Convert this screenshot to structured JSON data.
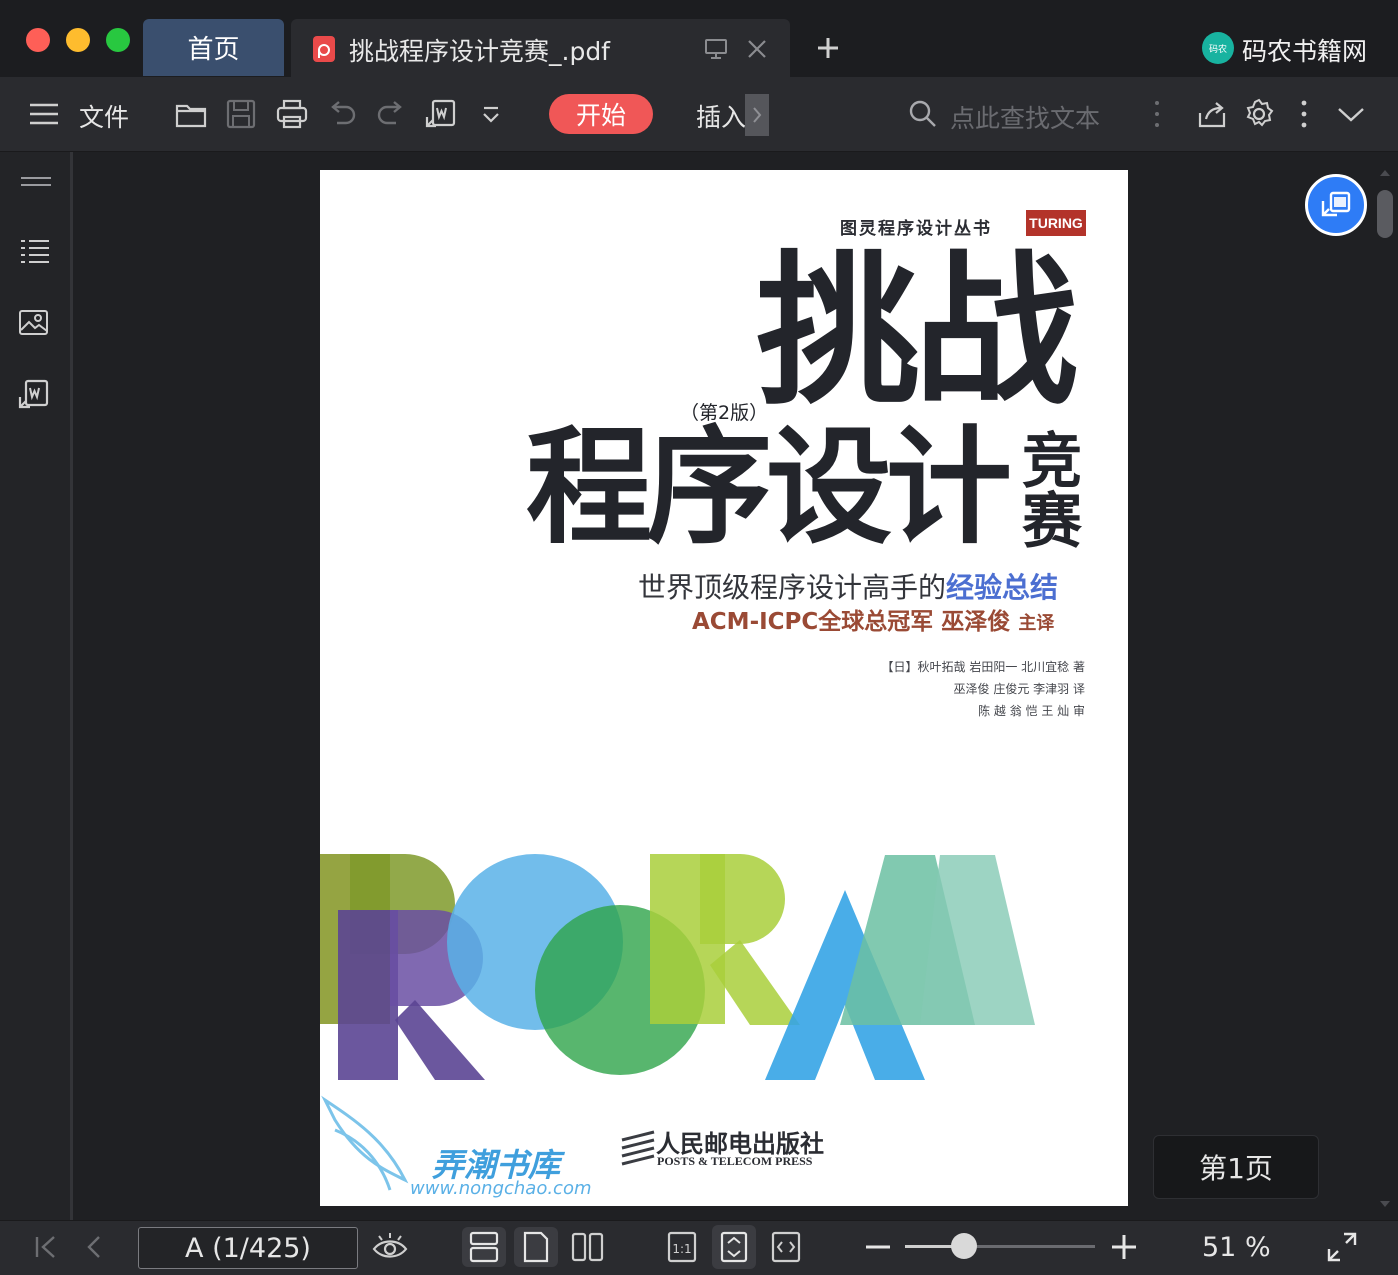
{
  "window": {
    "traffic_colors": [
      "#fe5f57",
      "#febc2e",
      "#28c840"
    ]
  },
  "tabs": [
    {
      "label": "首页"
    },
    {
      "label": "挑战程序设计竞赛_.pdf"
    }
  ],
  "brand": {
    "name": "码农书籍网",
    "logo_text": "码农"
  },
  "toolbar": {
    "file_label": "文件",
    "start_label": "开始",
    "insert_label": "插入",
    "search_placeholder": "点此查找文本"
  },
  "cover": {
    "series": "图灵程序设计丛书",
    "publisher_logo": "TURING",
    "title_line1": "挑战",
    "edition": "（第2版）",
    "title_line2": "程序设计",
    "title_side_1": "竞",
    "title_side_2": "赛",
    "subtitle_plain": "世界顶级程序设计高手的",
    "subtitle_highlight": "经验总结",
    "translator_line": "ACM-ICPC全球总冠军 巫泽俊",
    "translator_role": "主译",
    "credit_1": "【日】秋叶拓哉  岩田阳一  北川宜稔  著",
    "credit_2": "巫泽俊  庄俊元  李津羽  译",
    "credit_3": "陈  越  翁  恺  王  灿  审",
    "watermark_cn": "弄潮书库",
    "watermark_url": "www.nongchao.com",
    "press_cn": "人民邮电出版社",
    "press_en": "POSTS & TELECOM PRESS"
  },
  "page_badge": "第1页",
  "bottombar": {
    "page_indicator": "A (1/425)",
    "zoom_value": "51 %",
    "zoom_fraction": 0.31
  },
  "colors": {
    "accent_red": "#f05757",
    "accent_blue": "#2e7cf6",
    "tab_active": "#3a4f6e"
  }
}
